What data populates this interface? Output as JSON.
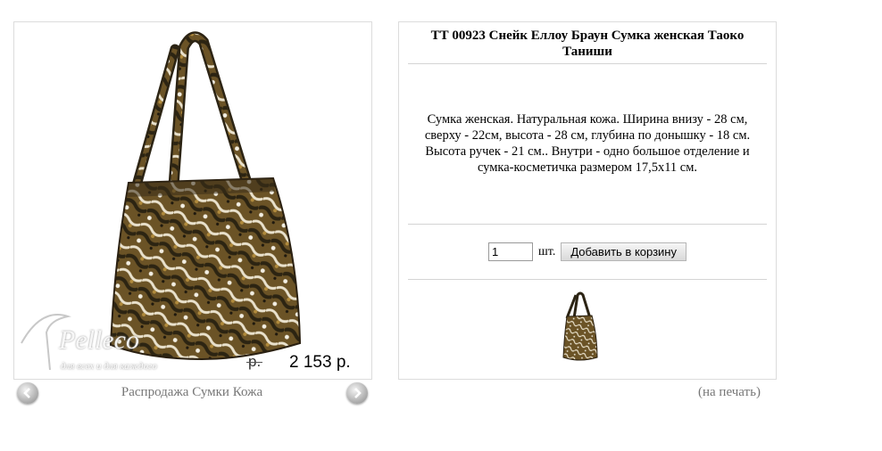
{
  "gallery": {
    "price": "2 153 р.",
    "old_price": "р.",
    "watermark_brand": "Pelleco",
    "watermark_slogan": "для всех и для каждого",
    "category_link": "Распродажа Сумки Кожа",
    "prev_icon": "chevron-left-icon",
    "next_icon": "chevron-right-icon"
  },
  "product": {
    "title": "ТТ 00923 Снейк Еллоу Браун Сумка женская Таоко Таниши",
    "description": "Сумка женская. Натуральная кожа. Ширина внизу - 28 см, сверху - 22см, высота - 28 см, глубина по донышку - 18 см. Высота ручек - 21 см.. Внутри - одно большое отделение и сумка-косметичка размером 17,5x11 см.",
    "quantity": "1",
    "unit": "шт.",
    "add_to_cart": "Добавить в корзину",
    "print_link": "(на печать)"
  },
  "colors": {
    "border": "#dcdcdc",
    "link": "#777777"
  }
}
